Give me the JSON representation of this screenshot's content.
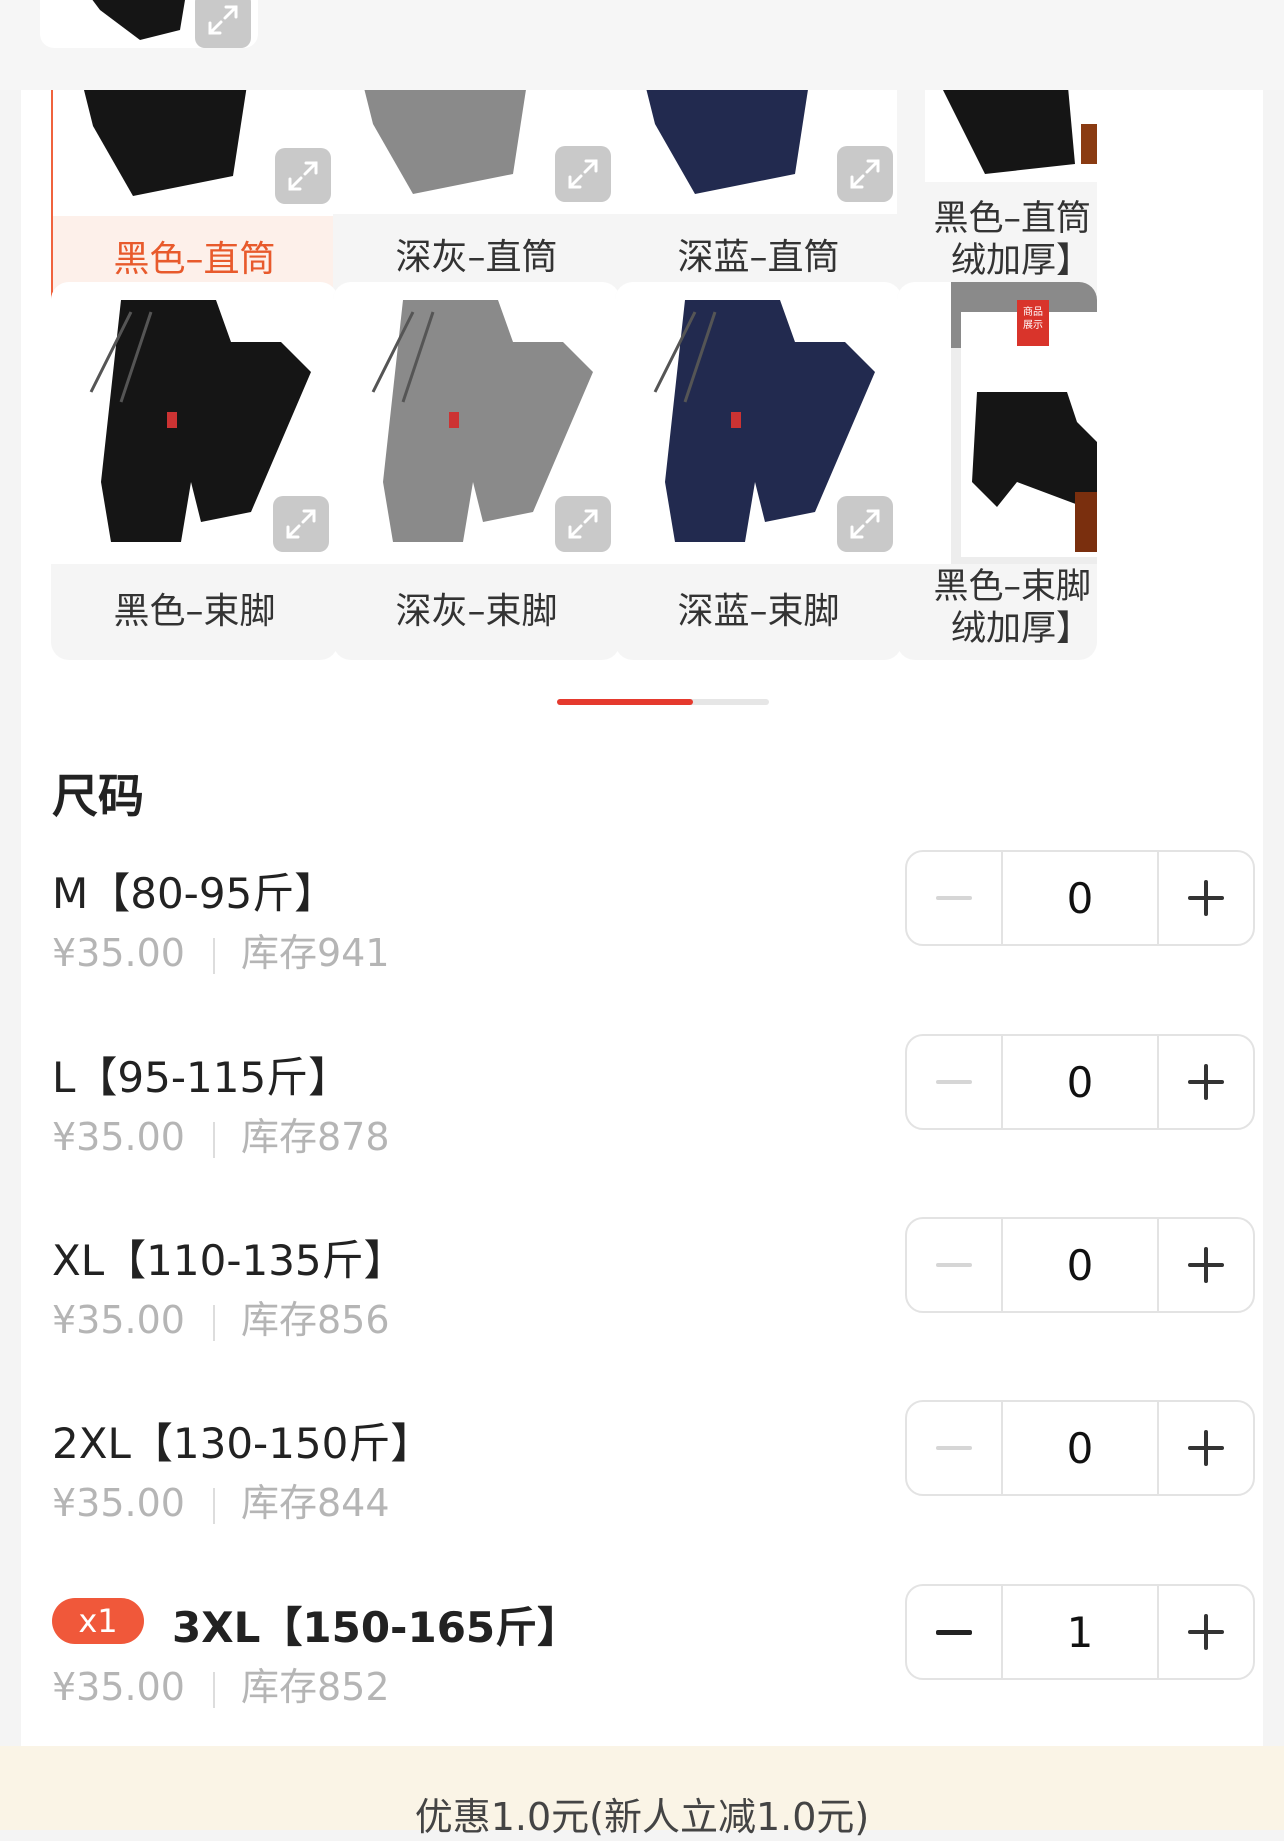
{
  "colors": {
    "accent": "#f0633e",
    "selected_bg": "#fdf0ea",
    "scroll_active": "#e53a2e",
    "badge": "#f0583a",
    "muted_text": "#b5b5b5",
    "promo_bg": "#faf4e6"
  },
  "variants": [
    {
      "label": "黑色–直筒",
      "color": "#151515",
      "style": "straight",
      "selected": true
    },
    {
      "label": "深灰–直筒",
      "color": "#8a8a8a",
      "style": "straight",
      "selected": false
    },
    {
      "label": "深蓝–直筒",
      "color": "#222a4f",
      "style": "straight",
      "selected": false
    },
    {
      "label": "黑色–直筒绒加厚】",
      "color": "#151515",
      "style": "straight-fleece",
      "selected": false
    },
    {
      "label": "黑色–束脚",
      "color": "#151515",
      "style": "jogger",
      "selected": false
    },
    {
      "label": "深灰–束脚",
      "color": "#8a8a8a",
      "style": "jogger",
      "selected": false
    },
    {
      "label": "深蓝–束脚",
      "color": "#222a4f",
      "style": "jogger",
      "selected": false
    },
    {
      "label": "黑色–束脚绒加厚】",
      "color": "#151515",
      "style": "jogger-fleece",
      "selected": false
    }
  ],
  "variant_labels": {
    "v0": "黑色–直筒",
    "v1": "深灰–直筒",
    "v2": "深蓝–直筒",
    "v3a": "黑色–直筒",
    "v3b": "绒加厚】",
    "v4": "黑色–束脚",
    "v5": "深灰–束脚",
    "v6": "深蓝–束脚",
    "v7a": "黑色–束脚",
    "v7b": "绒加厚】"
  },
  "thumb_overlay": {
    "tag_line1": "商品",
    "tag_line2": "展示"
  },
  "section_title": "尺码",
  "sizes": [
    {
      "name": "M【80-95斤】",
      "price": "¥35.00",
      "stock": "库存941",
      "qty": "0",
      "badge": ""
    },
    {
      "name": "L【95-115斤】",
      "price": "¥35.00",
      "stock": "库存878",
      "qty": "0",
      "badge": ""
    },
    {
      "name": "XL【110-135斤】",
      "price": "¥35.00",
      "stock": "库存856",
      "qty": "0",
      "badge": ""
    },
    {
      "name": "2XL【130-150斤】",
      "price": "¥35.00",
      "stock": "库存844",
      "qty": "0",
      "badge": ""
    },
    {
      "name": "3XL【150-165斤】",
      "price": "¥35.00",
      "stock": "库存852",
      "qty": "1",
      "badge": "x1"
    }
  ],
  "promo_text": "优惠1.0元(新人立减1.0元)"
}
